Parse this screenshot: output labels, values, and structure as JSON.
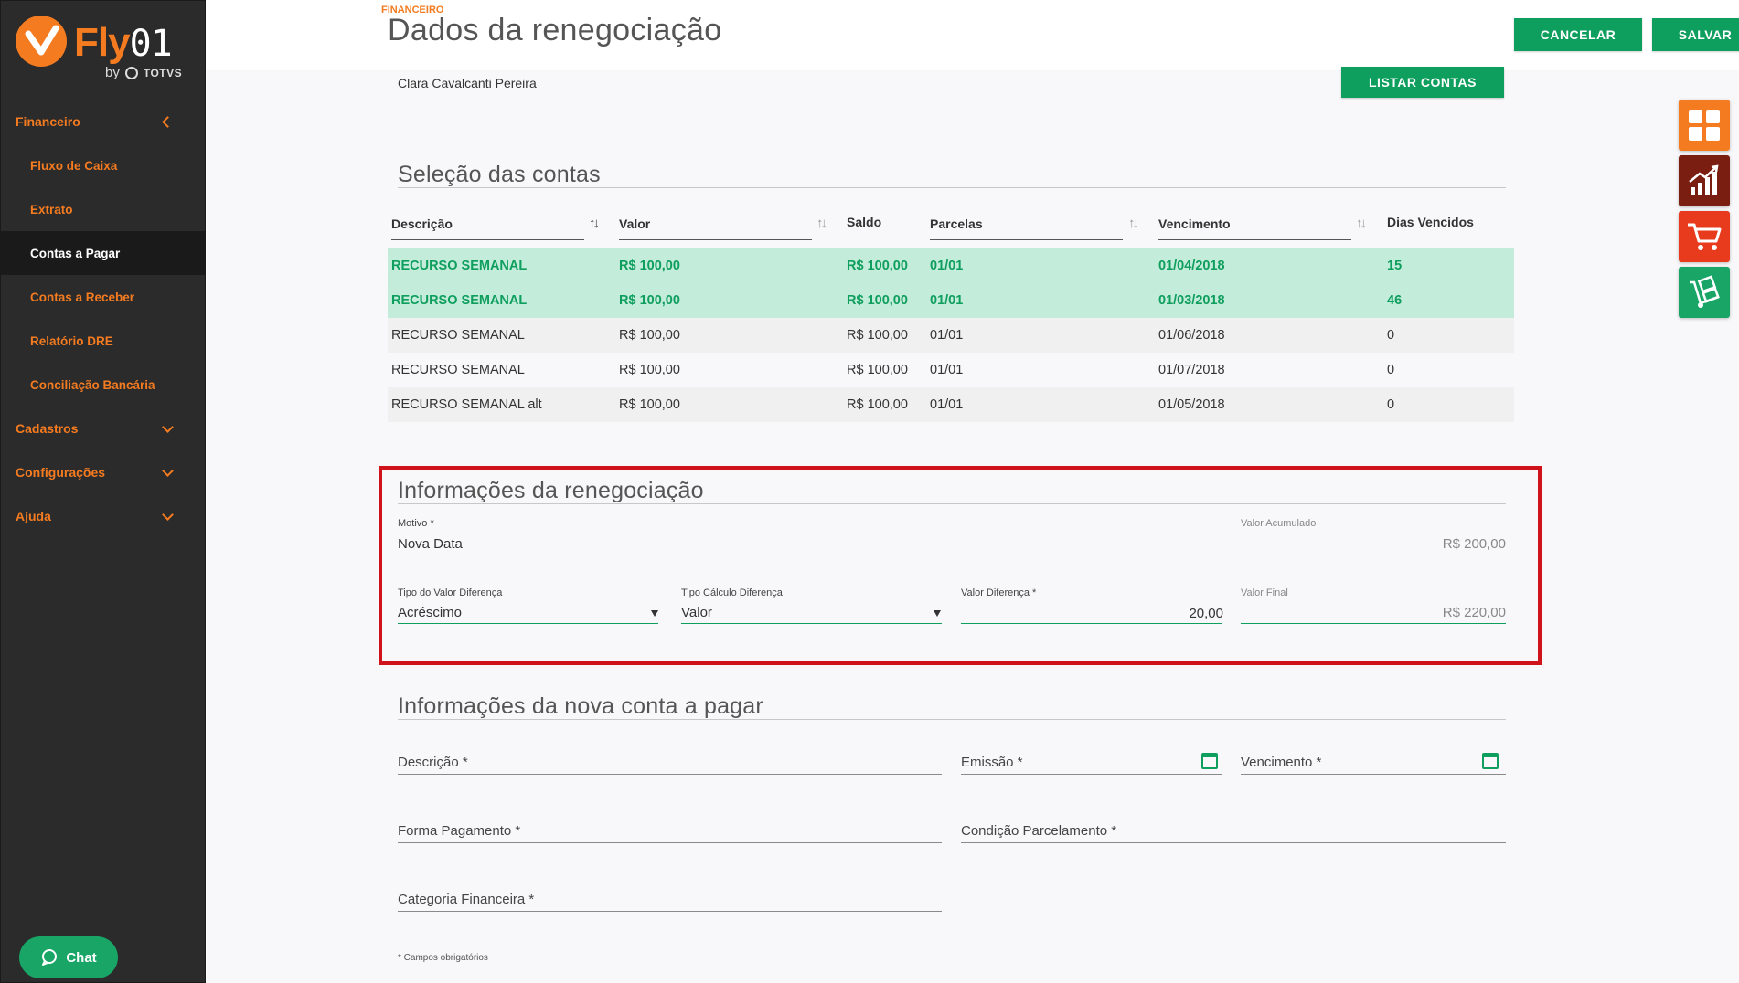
{
  "brand": {
    "name": "Fly",
    "suffix": "01",
    "by": "by",
    "company": "TOTVS"
  },
  "sidebar": {
    "items": [
      {
        "label": "Financeiro"
      },
      {
        "label": "Fluxo de Caixa"
      },
      {
        "label": "Extrato"
      },
      {
        "label": "Contas a Pagar"
      },
      {
        "label": "Contas a Receber"
      },
      {
        "label": "Relatório DRE"
      },
      {
        "label": "Conciliação Bancária"
      },
      {
        "label": "Cadastros"
      },
      {
        "label": "Configurações"
      },
      {
        "label": "Ajuda"
      }
    ],
    "chat_label": "Chat"
  },
  "header": {
    "breadcrumb": "FINANCEIRO",
    "title": "Dados da renegociação",
    "cancel_label": "CANCELAR",
    "save_label": "SALVAR"
  },
  "person": {
    "name": "Clara Cavalcanti Pereira",
    "list_label": "LISTAR CONTAS"
  },
  "selection": {
    "title": "Seleção das contas",
    "columns": [
      "Descrição",
      "Valor",
      "Saldo",
      "Parcelas",
      "Vencimento",
      "Dias Vencidos"
    ],
    "rows": [
      {
        "descricao": "RECURSO SEMANAL",
        "valor": "R$ 100,00",
        "saldo": "R$ 100,00",
        "parcelas": "01/01",
        "vencimento": "01/04/2018",
        "dias": "15"
      },
      {
        "descricao": "RECURSO SEMANAL",
        "valor": "R$ 100,00",
        "saldo": "R$ 100,00",
        "parcelas": "01/01",
        "vencimento": "01/03/2018",
        "dias": "46"
      },
      {
        "descricao": "RECURSO SEMANAL",
        "valor": "R$ 100,00",
        "saldo": "R$ 100,00",
        "parcelas": "01/01",
        "vencimento": "01/06/2018",
        "dias": "0"
      },
      {
        "descricao": "RECURSO SEMANAL",
        "valor": "R$ 100,00",
        "saldo": "R$ 100,00",
        "parcelas": "01/01",
        "vencimento": "01/07/2018",
        "dias": "0"
      },
      {
        "descricao": "RECURSO SEMANAL alt",
        "valor": "R$ 100,00",
        "saldo": "R$ 100,00",
        "parcelas": "01/01",
        "vencimento": "01/05/2018",
        "dias": "0"
      }
    ]
  },
  "renegotiation": {
    "title": "Informações da renegociação",
    "motivo_label": "Motivo *",
    "motivo_value": "Nova Data",
    "acumulado_label": "Valor Acumulado",
    "acumulado_value": "R$ 200,00",
    "tipo_valor_label": "Tipo do Valor Diferença",
    "tipo_valor_value": "Acréscimo",
    "tipo_calculo_label": "Tipo Cálculo Diferença",
    "tipo_calculo_value": "Valor",
    "valor_diferenca_label": "Valor Diferença *",
    "valor_diferenca_value": "20,00",
    "valor_final_label": "Valor Final",
    "valor_final_value": "R$ 220,00"
  },
  "new_account": {
    "title": "Informações da nova conta a pagar",
    "descricao": "Descrição *",
    "emissao": "Emissão *",
    "vencimento": "Vencimento *",
    "forma_pagamento": "Forma Pagamento *",
    "condicao": "Condição Parcelamento *",
    "categoria": "Categoria Financeira *",
    "note": "* Campos obrigatórios"
  },
  "apps": [
    {
      "icon": "grid-apps-icon",
      "color": "#f47b20"
    },
    {
      "icon": "bar-chart-icon",
      "color": "#7a1e12"
    },
    {
      "icon": "cart-icon",
      "color": "#e83a1c"
    },
    {
      "icon": "hand-truck-icon",
      "color": "#18a566"
    }
  ]
}
